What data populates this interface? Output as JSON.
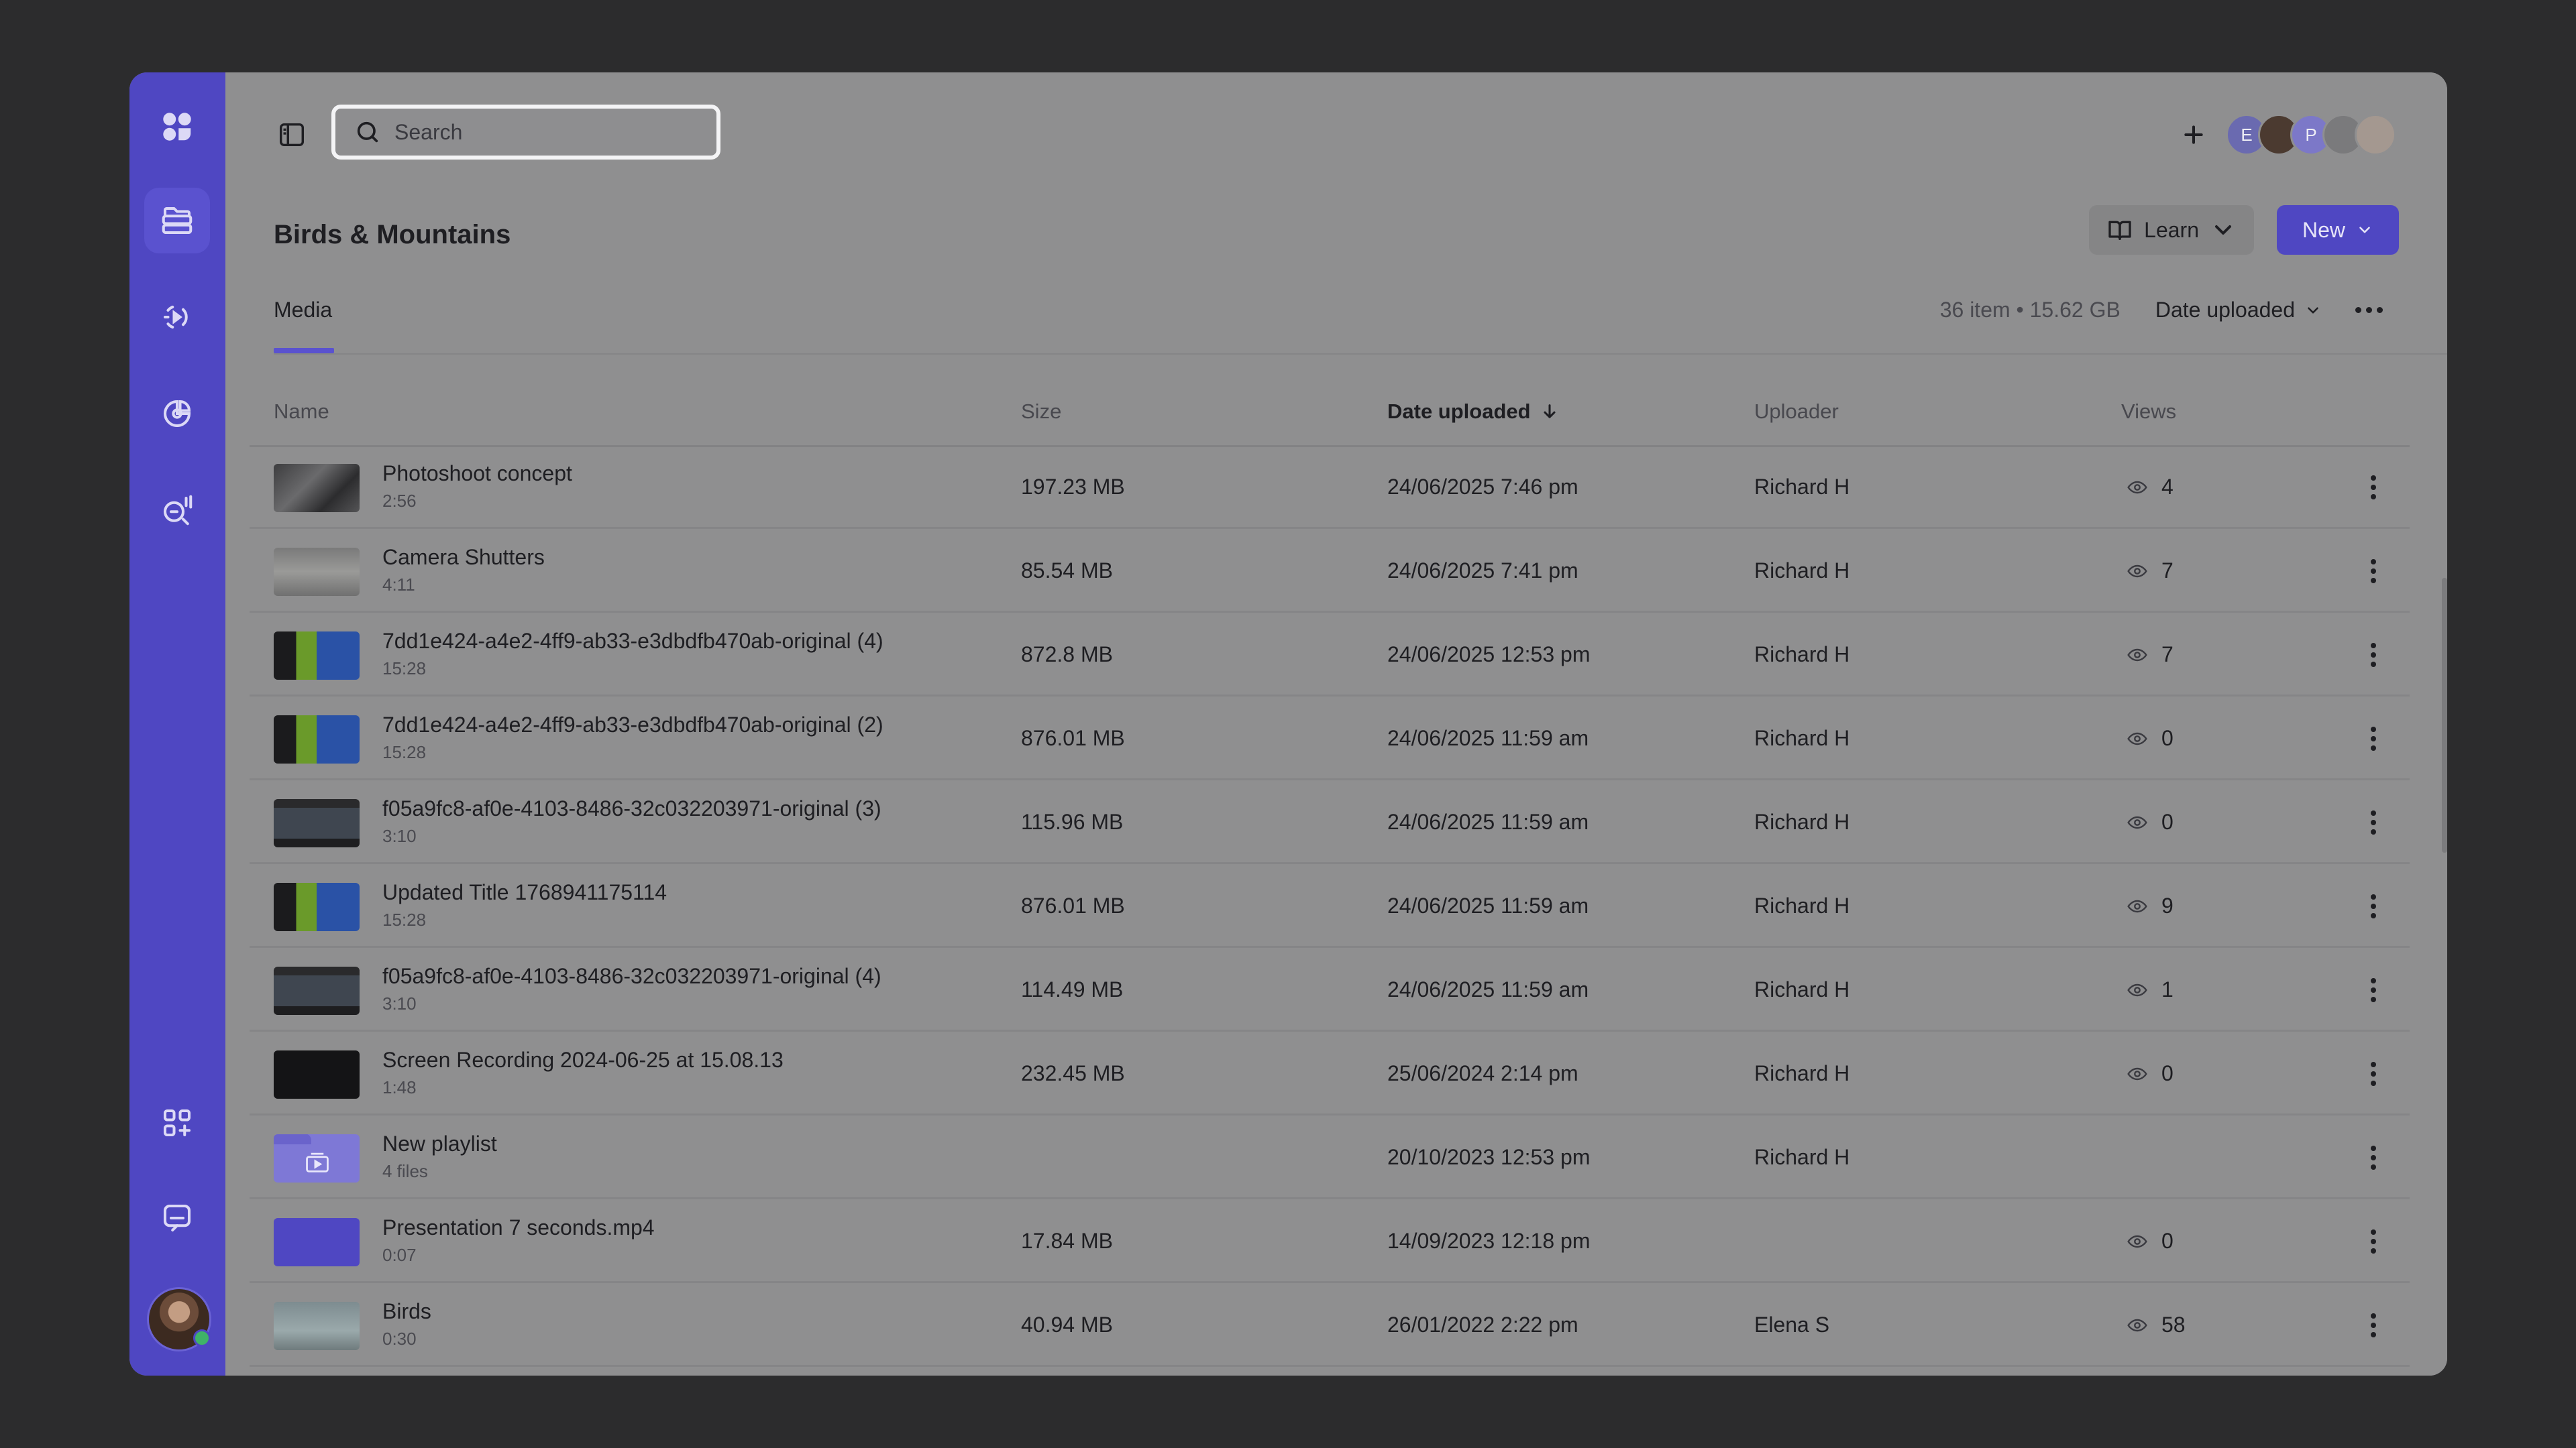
{
  "search": {
    "placeholder": "Search"
  },
  "page": {
    "title": "Birds & Mountains"
  },
  "buttons": {
    "learn": "Learn",
    "new": "New"
  },
  "tabs": [
    {
      "label": "Media"
    }
  ],
  "summary": {
    "count": "36 item • 15.62 GB",
    "sort": "Date uploaded"
  },
  "collaborators": [
    {
      "initial": "E",
      "color": "#6a6ab0"
    },
    {
      "initial": "",
      "color": "#4b3a30"
    },
    {
      "initial": "P",
      "color": "#7c78c8"
    },
    {
      "initial": "",
      "color": "#7a7a7c"
    },
    {
      "initial": "",
      "color": "#a49890"
    }
  ],
  "table": {
    "headers": {
      "name": "Name",
      "size": "Size",
      "date": "Date uploaded",
      "uploader": "Uploader",
      "views": "Views"
    },
    "rows": [
      {
        "name": "Photoshoot concept",
        "sub": "2:56",
        "size": "197.23 MB",
        "date": "24/06/2025 7:46 pm",
        "uploader": "Richard H",
        "views": "4",
        "thumb": "photo"
      },
      {
        "name": "Camera Shutters",
        "sub": "4:11",
        "size": "85.54 MB",
        "date": "24/06/2025 7:41 pm",
        "uploader": "Richard H",
        "views": "7",
        "thumb": "camera"
      },
      {
        "name": "7dd1e424-a4e2-4ff9-ab33-e3dbdfb470ab-original (4)",
        "sub": "15:28",
        "size": "872.8 MB",
        "date": "24/06/2025 12:53 pm",
        "uploader": "Richard H",
        "views": "7",
        "thumb": "tri"
      },
      {
        "name": "7dd1e424-a4e2-4ff9-ab33-e3dbdfb470ab-original (2)",
        "sub": "15:28",
        "size": "876.01 MB",
        "date": "24/06/2025 11:59 am",
        "uploader": "Richard H",
        "views": "0",
        "thumb": "tri"
      },
      {
        "name": "f05a9fc8-af0e-4103-8486-32c032203971-original (3)",
        "sub": "3:10",
        "size": "115.96 MB",
        "date": "24/06/2025 11:59 am",
        "uploader": "Richard H",
        "views": "0",
        "thumb": "screen"
      },
      {
        "name": "Updated Title 1768941175114",
        "sub": "15:28",
        "size": "876.01 MB",
        "date": "24/06/2025 11:59 am",
        "uploader": "Richard H",
        "views": "9",
        "thumb": "tri"
      },
      {
        "name": "f05a9fc8-af0e-4103-8486-32c032203971-original (4)",
        "sub": "3:10",
        "size": "114.49 MB",
        "date": "24/06/2025 11:59 am",
        "uploader": "Richard H",
        "views": "1",
        "thumb": "screen"
      },
      {
        "name": "Screen Recording 2024-06-25 at 15.08.13",
        "sub": "1:48",
        "size": "232.45 MB",
        "date": "25/06/2024 2:14 pm",
        "uploader": "Richard H",
        "views": "0",
        "thumb": "black"
      },
      {
        "name": "New playlist",
        "sub": "4 files",
        "size": "",
        "date": "20/10/2023 12:53 pm",
        "uploader": "Richard H",
        "views": "",
        "thumb": "folder"
      },
      {
        "name": "Presentation 7 seconds.mp4",
        "sub": "0:07",
        "size": "17.84 MB",
        "date": "14/09/2023 12:18 pm",
        "uploader": "",
        "views": "0",
        "thumb": "purple"
      },
      {
        "name": "Birds",
        "sub": "0:30",
        "size": "40.94 MB",
        "date": "26/01/2022 2:22 pm",
        "uploader": "Elena S",
        "views": "58",
        "thumb": "birds"
      }
    ]
  },
  "icons": {
    "sidebar": [
      "logo-icon",
      "library-icon",
      "podcast-icon",
      "analytics-icon",
      "ai-studio-icon",
      "apps-icon",
      "chat-icon"
    ]
  }
}
